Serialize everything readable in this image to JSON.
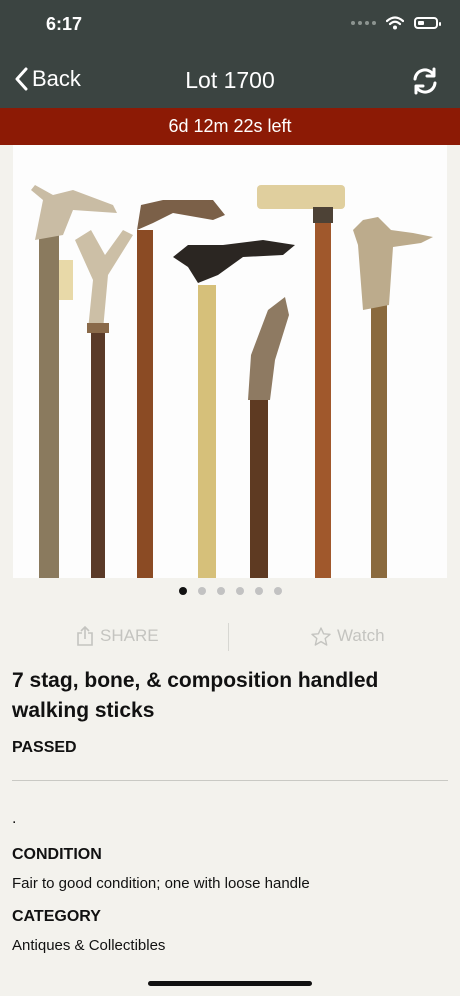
{
  "status_bar": {
    "time": "6:17"
  },
  "nav": {
    "back_label": "Back",
    "title": "Lot 1700"
  },
  "timer": {
    "text": "6d 12m 22s left"
  },
  "gallery": {
    "page_count": 6,
    "active_index": 0
  },
  "actions": {
    "share_label": "SHARE",
    "watch_label": "Watch"
  },
  "lot": {
    "title": "7 stag, bone, & composition handled walking sticks",
    "status": "PASSED",
    "description": "."
  },
  "condition": {
    "heading": "CONDITION",
    "text": "Fair to good condition; one with loose handle"
  },
  "category": {
    "heading": "CATEGORY",
    "text": "Antiques & Collectibles"
  },
  "colors": {
    "header_bg": "#3b4441",
    "timer_bg": "#8c1a05",
    "page_bg": "#f3f2ed"
  }
}
